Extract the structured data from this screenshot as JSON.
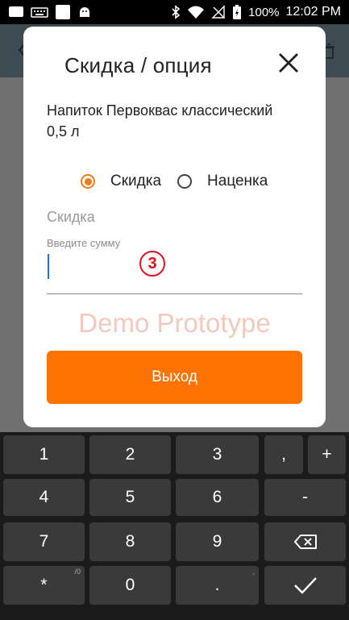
{
  "status_bar": {
    "battery": "100%",
    "time": "12:02 PM"
  },
  "dialog": {
    "title": "Скидка / опция",
    "product_name": "Напиток Первоквас классический 0,5 л",
    "options": [
      {
        "label": "Скидка",
        "selected": true
      },
      {
        "label": "Наценка",
        "selected": false
      }
    ],
    "section_label": "Скидка",
    "input": {
      "hint": "Введите сумму",
      "value": ""
    },
    "step_badge": "3",
    "watermark": "Demo Prototype",
    "exit_button": "Выход"
  },
  "keypad": {
    "rows": [
      [
        "1",
        "2",
        "3",
        ",",
        "+"
      ],
      [
        "4",
        "5",
        "6",
        "-"
      ],
      [
        "7",
        "8",
        "9",
        "backspace"
      ],
      [
        "*",
        "0",
        ".",
        "enter"
      ]
    ],
    "sublabels": {
      "*": "/0",
      ".": ","
    }
  },
  "colors": {
    "accent": "#ff7300",
    "radio": "#f47a14",
    "badge": "#e5101a"
  }
}
